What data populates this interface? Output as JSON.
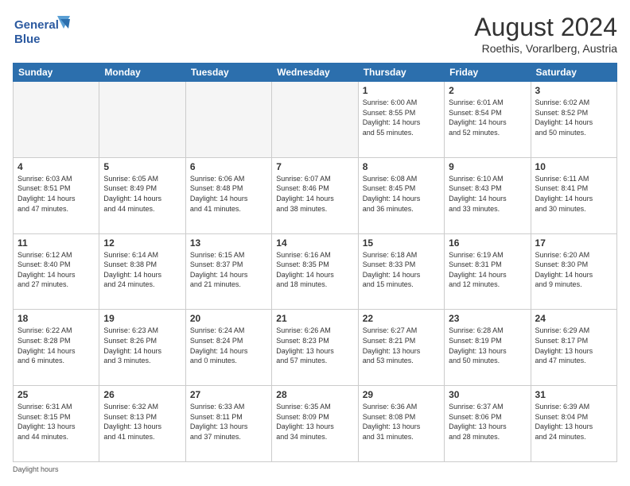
{
  "logo": {
    "line1": "General",
    "line2": "Blue"
  },
  "title": "August 2024",
  "subtitle": "Roethis, Vorarlberg, Austria",
  "headers": [
    "Sunday",
    "Monday",
    "Tuesday",
    "Wednesday",
    "Thursday",
    "Friday",
    "Saturday"
  ],
  "weeks": [
    [
      {
        "day": "",
        "info": ""
      },
      {
        "day": "",
        "info": ""
      },
      {
        "day": "",
        "info": ""
      },
      {
        "day": "",
        "info": ""
      },
      {
        "day": "1",
        "info": "Sunrise: 6:00 AM\nSunset: 8:55 PM\nDaylight: 14 hours\nand 55 minutes."
      },
      {
        "day": "2",
        "info": "Sunrise: 6:01 AM\nSunset: 8:54 PM\nDaylight: 14 hours\nand 52 minutes."
      },
      {
        "day": "3",
        "info": "Sunrise: 6:02 AM\nSunset: 8:52 PM\nDaylight: 14 hours\nand 50 minutes."
      }
    ],
    [
      {
        "day": "4",
        "info": "Sunrise: 6:03 AM\nSunset: 8:51 PM\nDaylight: 14 hours\nand 47 minutes."
      },
      {
        "day": "5",
        "info": "Sunrise: 6:05 AM\nSunset: 8:49 PM\nDaylight: 14 hours\nand 44 minutes."
      },
      {
        "day": "6",
        "info": "Sunrise: 6:06 AM\nSunset: 8:48 PM\nDaylight: 14 hours\nand 41 minutes."
      },
      {
        "day": "7",
        "info": "Sunrise: 6:07 AM\nSunset: 8:46 PM\nDaylight: 14 hours\nand 38 minutes."
      },
      {
        "day": "8",
        "info": "Sunrise: 6:08 AM\nSunset: 8:45 PM\nDaylight: 14 hours\nand 36 minutes."
      },
      {
        "day": "9",
        "info": "Sunrise: 6:10 AM\nSunset: 8:43 PM\nDaylight: 14 hours\nand 33 minutes."
      },
      {
        "day": "10",
        "info": "Sunrise: 6:11 AM\nSunset: 8:41 PM\nDaylight: 14 hours\nand 30 minutes."
      }
    ],
    [
      {
        "day": "11",
        "info": "Sunrise: 6:12 AM\nSunset: 8:40 PM\nDaylight: 14 hours\nand 27 minutes."
      },
      {
        "day": "12",
        "info": "Sunrise: 6:14 AM\nSunset: 8:38 PM\nDaylight: 14 hours\nand 24 minutes."
      },
      {
        "day": "13",
        "info": "Sunrise: 6:15 AM\nSunset: 8:37 PM\nDaylight: 14 hours\nand 21 minutes."
      },
      {
        "day": "14",
        "info": "Sunrise: 6:16 AM\nSunset: 8:35 PM\nDaylight: 14 hours\nand 18 minutes."
      },
      {
        "day": "15",
        "info": "Sunrise: 6:18 AM\nSunset: 8:33 PM\nDaylight: 14 hours\nand 15 minutes."
      },
      {
        "day": "16",
        "info": "Sunrise: 6:19 AM\nSunset: 8:31 PM\nDaylight: 14 hours\nand 12 minutes."
      },
      {
        "day": "17",
        "info": "Sunrise: 6:20 AM\nSunset: 8:30 PM\nDaylight: 14 hours\nand 9 minutes."
      }
    ],
    [
      {
        "day": "18",
        "info": "Sunrise: 6:22 AM\nSunset: 8:28 PM\nDaylight: 14 hours\nand 6 minutes."
      },
      {
        "day": "19",
        "info": "Sunrise: 6:23 AM\nSunset: 8:26 PM\nDaylight: 14 hours\nand 3 minutes."
      },
      {
        "day": "20",
        "info": "Sunrise: 6:24 AM\nSunset: 8:24 PM\nDaylight: 14 hours\nand 0 minutes."
      },
      {
        "day": "21",
        "info": "Sunrise: 6:26 AM\nSunset: 8:23 PM\nDaylight: 13 hours\nand 57 minutes."
      },
      {
        "day": "22",
        "info": "Sunrise: 6:27 AM\nSunset: 8:21 PM\nDaylight: 13 hours\nand 53 minutes."
      },
      {
        "day": "23",
        "info": "Sunrise: 6:28 AM\nSunset: 8:19 PM\nDaylight: 13 hours\nand 50 minutes."
      },
      {
        "day": "24",
        "info": "Sunrise: 6:29 AM\nSunset: 8:17 PM\nDaylight: 13 hours\nand 47 minutes."
      }
    ],
    [
      {
        "day": "25",
        "info": "Sunrise: 6:31 AM\nSunset: 8:15 PM\nDaylight: 13 hours\nand 44 minutes."
      },
      {
        "day": "26",
        "info": "Sunrise: 6:32 AM\nSunset: 8:13 PM\nDaylight: 13 hours\nand 41 minutes."
      },
      {
        "day": "27",
        "info": "Sunrise: 6:33 AM\nSunset: 8:11 PM\nDaylight: 13 hours\nand 37 minutes."
      },
      {
        "day": "28",
        "info": "Sunrise: 6:35 AM\nSunset: 8:09 PM\nDaylight: 13 hours\nand 34 minutes."
      },
      {
        "day": "29",
        "info": "Sunrise: 6:36 AM\nSunset: 8:08 PM\nDaylight: 13 hours\nand 31 minutes."
      },
      {
        "day": "30",
        "info": "Sunrise: 6:37 AM\nSunset: 8:06 PM\nDaylight: 13 hours\nand 28 minutes."
      },
      {
        "day": "31",
        "info": "Sunrise: 6:39 AM\nSunset: 8:04 PM\nDaylight: 13 hours\nand 24 minutes."
      }
    ]
  ],
  "footer": "Daylight hours"
}
